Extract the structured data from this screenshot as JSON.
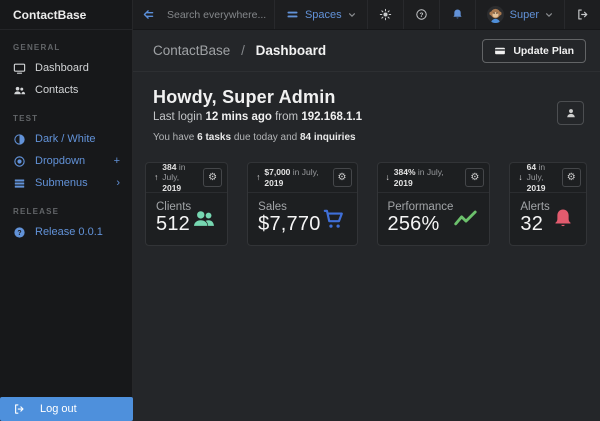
{
  "brand": "ContactBase",
  "sidebar": {
    "sections": [
      {
        "label": "GENERAL",
        "items": [
          {
            "label": "Dashboard",
            "icon": "monitor-icon"
          },
          {
            "label": "Contacts",
            "icon": "people-icon"
          }
        ]
      },
      {
        "label": "TEST",
        "items": [
          {
            "label": "Dark / White",
            "icon": "theme-contrast-icon"
          },
          {
            "label": "Dropdown",
            "icon": "dot-circle-icon",
            "suffix": "+"
          },
          {
            "label": "Submenus",
            "icon": "rows-icon",
            "suffix": "›"
          }
        ]
      },
      {
        "label": "RELEASE",
        "items": [
          {
            "label": "Release 0.0.1",
            "icon": "question-circle-icon"
          }
        ]
      }
    ],
    "logout_label": "Log out"
  },
  "navbar": {
    "search_placeholder": "Search everywhere...",
    "spaces_label": "Spaces",
    "user_name": "Super"
  },
  "breadcrumb": {
    "parent": "ContactBase",
    "separator": "/",
    "current": "Dashboard"
  },
  "page_actions": {
    "update_plan": "Update Plan"
  },
  "welcome": {
    "title": "Howdy, Super Admin",
    "login_line": {
      "pre": "Last login",
      "time": "12 mins ago",
      "mid": "from",
      "ip": "192.168.1.1"
    },
    "tasks_line": {
      "pre": "You have",
      "tasks": "6 tasks",
      "mid": "due today and",
      "inquiries": "84 inquiries"
    }
  },
  "cards": [
    {
      "arrow": "↑",
      "trend_value": "384",
      "trend_mid": "in July,",
      "trend_year": "2019",
      "label": "Clients",
      "value": "512",
      "icon": "people-icon",
      "accent": "#76d7b1"
    },
    {
      "arrow": "↑",
      "trend_value": "$7,000",
      "trend_mid": "in July,",
      "trend_year": "2019",
      "label": "Sales",
      "value": "$7,770",
      "icon": "cart-icon",
      "accent": "#3f6fd8"
    },
    {
      "arrow": "↓",
      "trend_value": "384%",
      "trend_mid": "in July,",
      "trend_year": "2019",
      "label": "Performance",
      "value": "256%",
      "icon": "trend-icon",
      "accent": "#6cc16c"
    },
    {
      "arrow": "↓",
      "trend_value": "64",
      "trend_mid": "in July,",
      "trend_year": "2019",
      "label": "Alerts",
      "value": "32",
      "icon": "bell-icon",
      "accent": "#e25b6e"
    }
  ],
  "icons": {
    "gear": "⚙"
  },
  "colors": {
    "accent_blue": "#5b8fd9",
    "logout_bg": "#4e90dc",
    "mint": "#76d7b1",
    "cart_blue": "#3f6fd8",
    "green": "#6cc16c",
    "rose": "#e25b6e",
    "sidebar_bg": "#17181a",
    "navbar_bg": "#1d1e20",
    "content_bg": "#242629",
    "card_bg": "#1d1f21"
  }
}
